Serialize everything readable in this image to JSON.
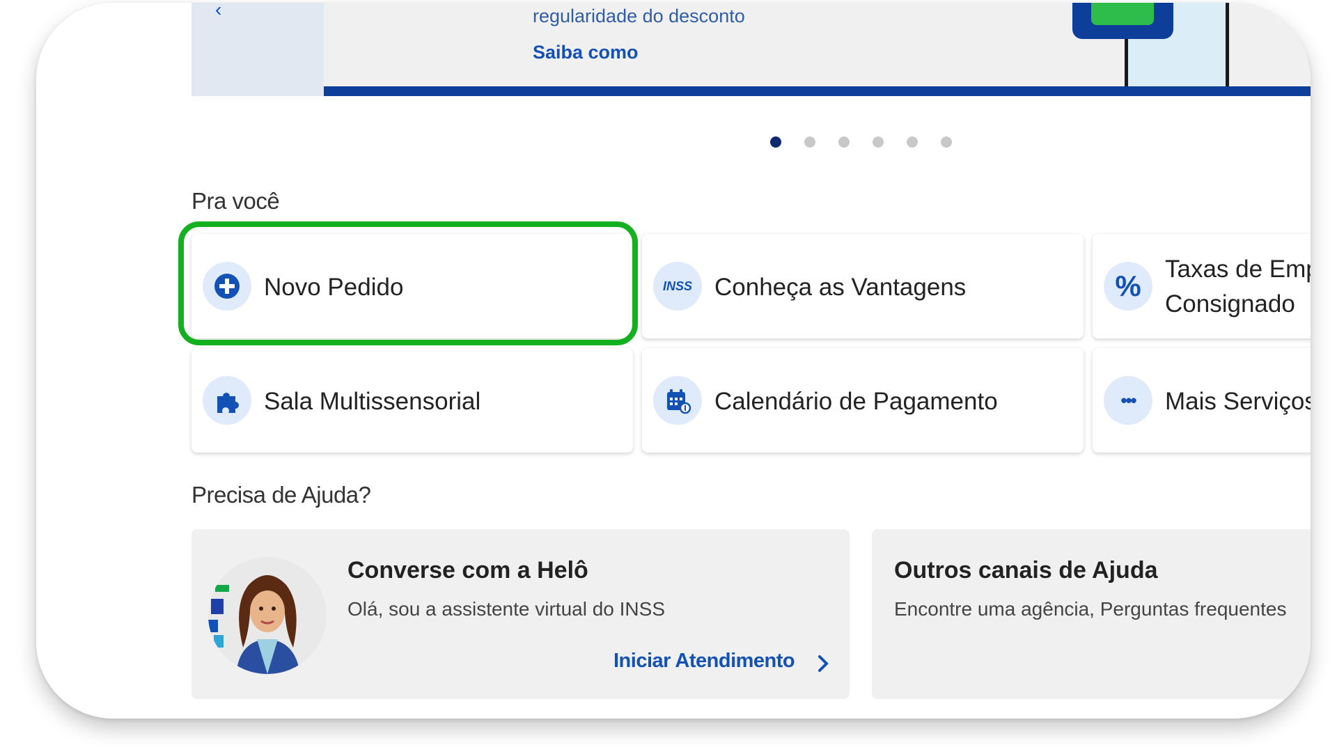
{
  "banner": {
    "text_line": "regularidade do desconto",
    "link": "Saiba como"
  },
  "carousel": {
    "total": 6,
    "active_index": 0
  },
  "pra_voce": {
    "title": "Pra você",
    "items": [
      {
        "label": "Novo Pedido",
        "icon": "plus-circle-icon"
      },
      {
        "label": "Conheça as Vantagens",
        "icon": "meu-inss-icon",
        "icon_text": "INSS"
      },
      {
        "label_line1": "Taxas de Emp",
        "label_line2": "Consignado",
        "icon": "percent-icon",
        "icon_text": "%"
      },
      {
        "label": "Sala Multissensorial",
        "icon": "puzzle-icon"
      },
      {
        "label": "Calendário de Pagamento",
        "icon": "calendar-icon"
      },
      {
        "label": "Mais Serviços",
        "icon": "more-dots-icon",
        "icon_text": "•••"
      }
    ]
  },
  "ajuda": {
    "title": "Precisa de Ajuda?",
    "helo": {
      "title": "Converse com a Helô",
      "text": "Olá, sou a assistente virtual do INSS",
      "link": "Iniciar Atendimento"
    },
    "outros": {
      "title": "Outros canais de Ajuda",
      "text": "Encontre uma agência, Perguntas frequentes"
    }
  },
  "colors": {
    "primary": "#1351b4",
    "navy": "#0c3e9a",
    "highlight": "#13b01f",
    "icon_bg": "#dfeafa"
  }
}
